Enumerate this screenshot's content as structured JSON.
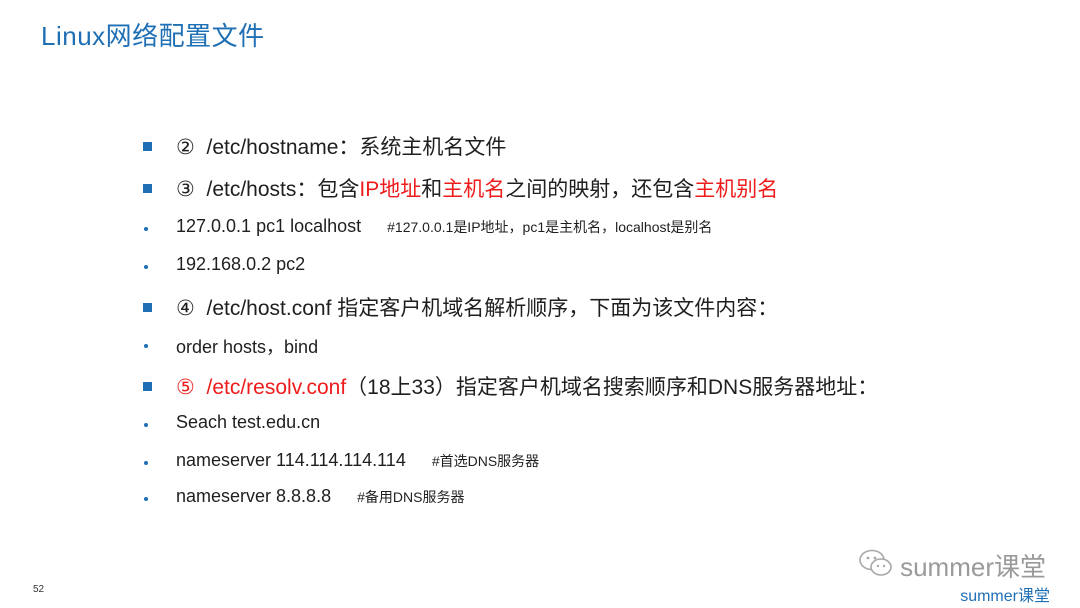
{
  "title": "Linux网络配置文件",
  "items": [
    {
      "marker": "②",
      "path": "/etc/hostname",
      "sep": "：",
      "text": "系统主机名文件"
    },
    {
      "marker": "③",
      "path": "/etc/hosts",
      "sep": "：",
      "t1": "包含",
      "r1": "IP地址",
      "t2": "和",
      "r2": "主机名",
      "t3": "之间的映射，还包含",
      "r3": "主机别名"
    },
    {
      "text": "127.0.0.1 pc1  localhost",
      "comment": "#127.0.0.1是IP地址，pc1是主机名，localhost是别名"
    },
    {
      "text": "192.168.0.2 pc2"
    },
    {
      "marker": "④",
      "path": "/etc/host.conf",
      "text": " 指定客户机域名解析顺序，下面为该文件内容："
    },
    {
      "text": "order hosts，bind"
    },
    {
      "marker": "⑤",
      "path": "/etc/resolv.conf",
      "paren": "（18上33）",
      "text": "指定客户机域名搜索顺序和DNS服务器地址："
    },
    {
      "text": "Seach test.edu.cn"
    },
    {
      "text": "nameserver 114.114.114.114",
      "comment": "#首选DNS服务器"
    },
    {
      "text": "nameserver 8.8.8.8",
      "comment": "#备用DNS服务器"
    }
  ],
  "page_number": "52",
  "watermark": "summer课堂",
  "brand": "summer课堂",
  "colors": {
    "accent": "#1f6fb5",
    "highlight": "#ee1c1c"
  }
}
